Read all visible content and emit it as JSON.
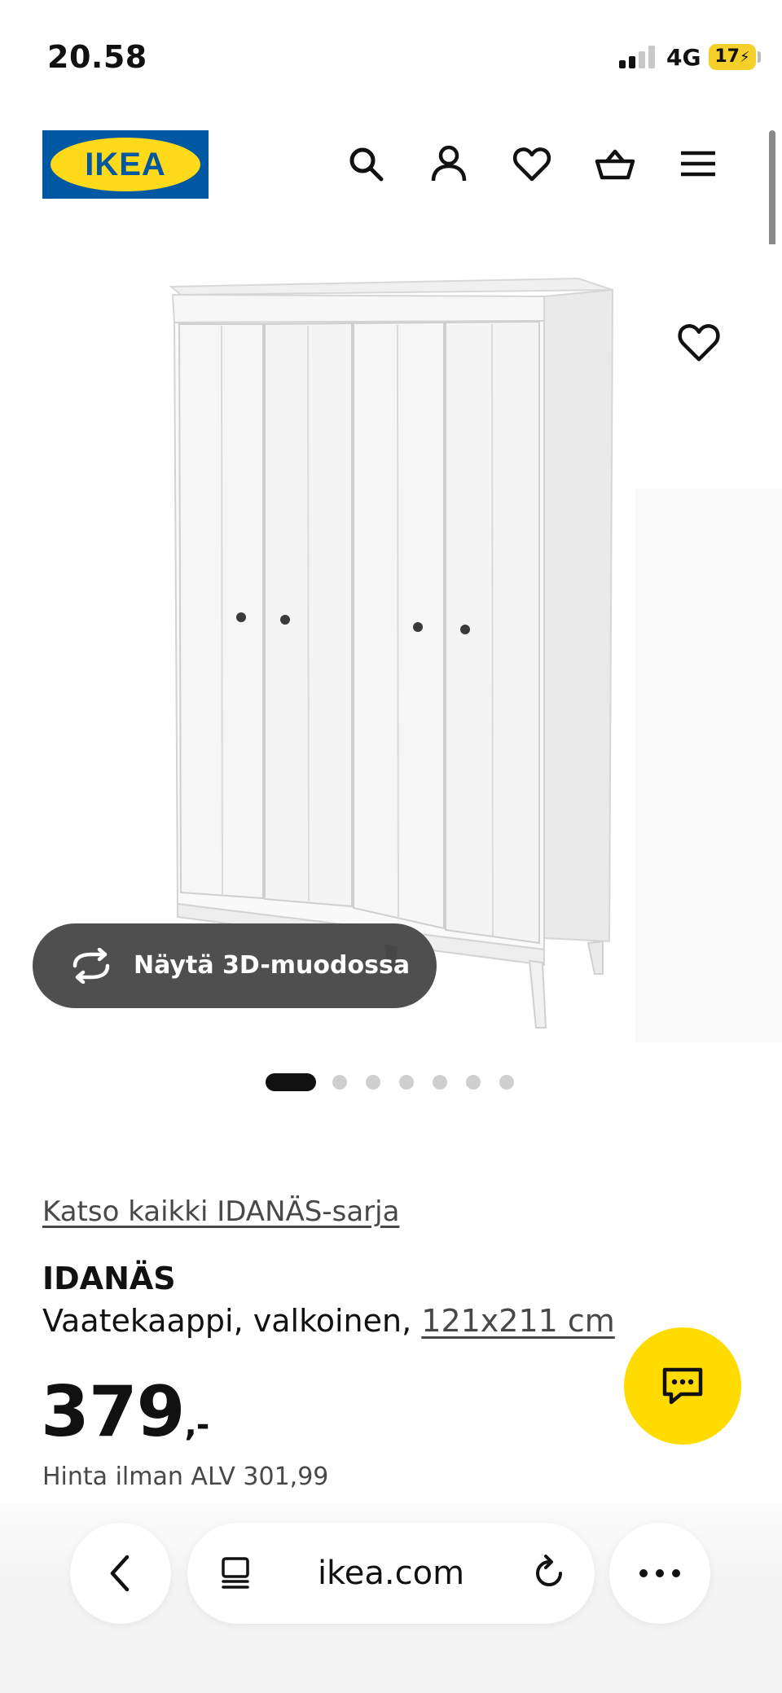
{
  "status_bar": {
    "time": "20.58",
    "network": "4G",
    "battery": "17"
  },
  "header": {
    "logo_text": "IKEA",
    "icons": [
      "search-icon",
      "account-icon",
      "wishlist-icon",
      "basket-icon",
      "menu-icon"
    ]
  },
  "gallery": {
    "view_3d_label": "Näytä 3D-muodossa",
    "image_count": 7,
    "active_index": 0
  },
  "product": {
    "series_link": "Katso kaikki IDANÄS-sarja",
    "name": "IDANÄS",
    "description": "Vaatekaappi, valkoinen, ",
    "size": "121x211 cm",
    "price": "379",
    "price_suffix": ",-",
    "price_without_vat": "Hinta ilman ALV 301,99"
  },
  "browser": {
    "url": "ikea.com"
  },
  "colors": {
    "ikea_blue": "#0058a3",
    "ikea_yellow": "#ffda1a",
    "chat_yellow": "#ffdb00",
    "button_dark": "#484848"
  }
}
